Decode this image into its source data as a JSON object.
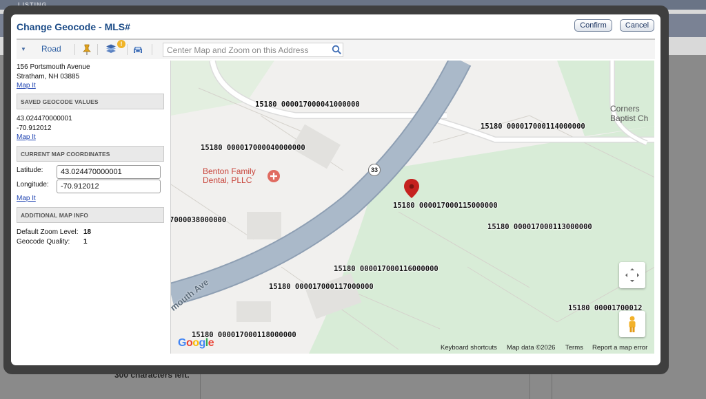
{
  "background": {
    "topbar_label": "LISTING",
    "chars_left": "300 characters left."
  },
  "dialog": {
    "title": "Change Geocode - MLS#",
    "confirm_label": "Confirm",
    "cancel_label": "Cancel"
  },
  "toolbar": {
    "map_type": "Road",
    "badge": "!",
    "search_placeholder": "Center Map and Zoom on this Address",
    "icons": [
      "chevron-down-icon",
      "pushpin-icon",
      "layers-icon",
      "car-icon",
      "search-icon"
    ]
  },
  "address": {
    "line1": "156 Portsmouth Avenue",
    "line2": "Stratham, NH 03885",
    "map_it": "Map It"
  },
  "saved": {
    "header": "SAVED GEOCODE VALUES",
    "lat": "43.024470000001",
    "lng": "-70.912012",
    "map_it": "Map It"
  },
  "current": {
    "header": "CURRENT MAP COORDINATES",
    "lat_label": "Latitude:",
    "lat_value": "43.024470000001",
    "lng_label": "Longitude:",
    "lng_value": "-70.912012",
    "map_it": "Map It"
  },
  "additional": {
    "header": "ADDITIONAL MAP INFO",
    "zoom_label": "Default Zoom Level:",
    "zoom_value": "18",
    "quality_label": "Geocode Quality:",
    "quality_value": "1"
  },
  "map": {
    "parcels": [
      "15180 000017000041000000",
      "15180 000017000114000000",
      "15180 000017000040000000",
      "7000038000000",
      "15180 000017000115000000",
      "15180 000017000113000000",
      "15180 000017000116000000",
      "15180 000017000117000000",
      "15180 000017000118000000",
      "15180 00001700012"
    ],
    "poi_line1": "Benton Family",
    "poi_line2": "Dental, PLLC",
    "route_number": "33",
    "road_name": "mouth Ave",
    "place_line1": "Corners",
    "place_line2": "Baptist Ch",
    "google": "Google",
    "footer": {
      "shortcuts": "Keyboard shortcuts",
      "data": "Map data ©2026",
      "terms": "Terms",
      "report": "Report a map error"
    },
    "colors": {
      "green": "#d8ecd7",
      "road": "#aab9c9",
      "marker": "#c5221f"
    }
  }
}
